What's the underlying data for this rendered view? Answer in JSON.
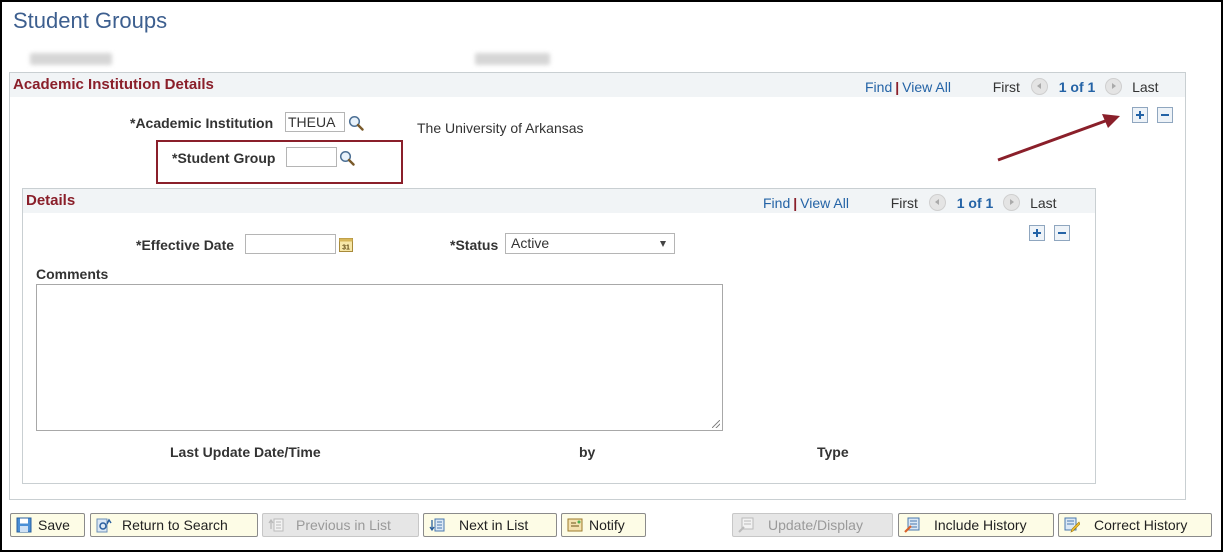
{
  "page": {
    "title": "Student Groups",
    "person_name_redacted": "",
    "person_id_redacted": ""
  },
  "institution_panel": {
    "title": "Academic Institution Details",
    "nav": {
      "find": "Find",
      "view_all": "View All",
      "first": "First",
      "count": "1 of 1",
      "last": "Last"
    },
    "academic_institution_label": "*Academic Institution",
    "academic_institution_value": "THEUA",
    "academic_institution_desc": "The University of Arkansas",
    "student_group_label": "*Student Group",
    "student_group_value": ""
  },
  "details_panel": {
    "title": "Details",
    "nav": {
      "find": "Find",
      "view_all": "View All",
      "first": "First",
      "count": "1 of 1",
      "last": "Last"
    },
    "effective_date_label": "*Effective Date",
    "effective_date_value": "",
    "status_label": "*Status",
    "status_value": "Active",
    "comments_label": "Comments",
    "comments_value": "",
    "last_update_label": "Last Update Date/Time",
    "by_label": "by",
    "type_label": "Type"
  },
  "toolbar": {
    "save": "Save",
    "return_to_search": "Return to Search",
    "previous_in_list": "Previous in List",
    "next_in_list": "Next in List",
    "notify": "Notify",
    "update_display": "Update/Display",
    "include_history": "Include History",
    "correct_history": "Correct History"
  },
  "colors": {
    "title_blue": "#3d5f8f",
    "section_red": "#8a1f2a",
    "link_blue": "#2463a6",
    "button_bg": "#fdfce6"
  }
}
